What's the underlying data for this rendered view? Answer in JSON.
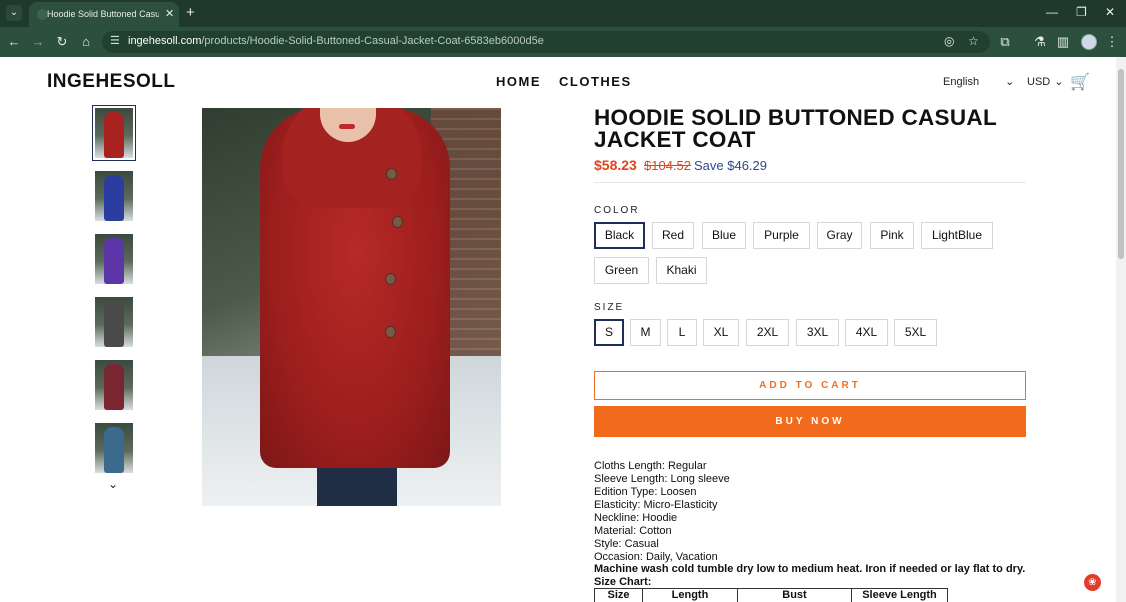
{
  "browser": {
    "tab_title": "Hoodie Solid Buttoned Casual J",
    "url_host": "ingehesoll.com",
    "url_path": "/products/Hoodie-Solid-Buttoned-Casual-Jacket-Coat-6583eb6000d5e"
  },
  "store": {
    "logo": "INGEHESOLL",
    "nav": [
      "HOME",
      "CLOTHES"
    ],
    "language": "English",
    "currency": "USD"
  },
  "product": {
    "title": "Hoodie Solid Buttoned Casual Jacket Coat",
    "price_now": "$58.23",
    "price_was": "$104.52",
    "save": "Save $46.29",
    "thumbnail_colors": [
      "#a8231f",
      "#2b3ea0",
      "#5c35a8",
      "#4a4a4a",
      "#7a2630",
      "#3c6a8c"
    ],
    "color_label": "COLOR",
    "colors": [
      "Black",
      "Red",
      "Blue",
      "Purple",
      "Gray",
      "Pink",
      "LightBlue",
      "Green",
      "Khaki"
    ],
    "selected_color": "Black",
    "size_label": "SIZE",
    "sizes": [
      "S",
      "M",
      "L",
      "XL",
      "2XL",
      "3XL",
      "4XL",
      "5XL"
    ],
    "selected_size": "S",
    "add_to_cart": "ADD TO CART",
    "buy_now": "BUY NOW",
    "specs": [
      "Cloths Length: Regular",
      "Sleeve Length: Long sleeve",
      "Edition Type: Loosen",
      "Elasticity: Micro-Elasticity",
      "Neckline: Hoodie",
      "Material: Cotton",
      "Style: Casual",
      "Occasion: Daily, Vacation"
    ],
    "care": "Machine wash cold tumble dry low to medium heat. Iron if needed or lay flat to dry.",
    "size_chart_label": "Size Chart:",
    "size_chart_headers": [
      "Size",
      "Length",
      "Bust",
      "Sleeve Length"
    ]
  },
  "colors": {
    "accent": "#f26b1d",
    "price": "#e0441f",
    "selected": "#1f2d5c"
  }
}
